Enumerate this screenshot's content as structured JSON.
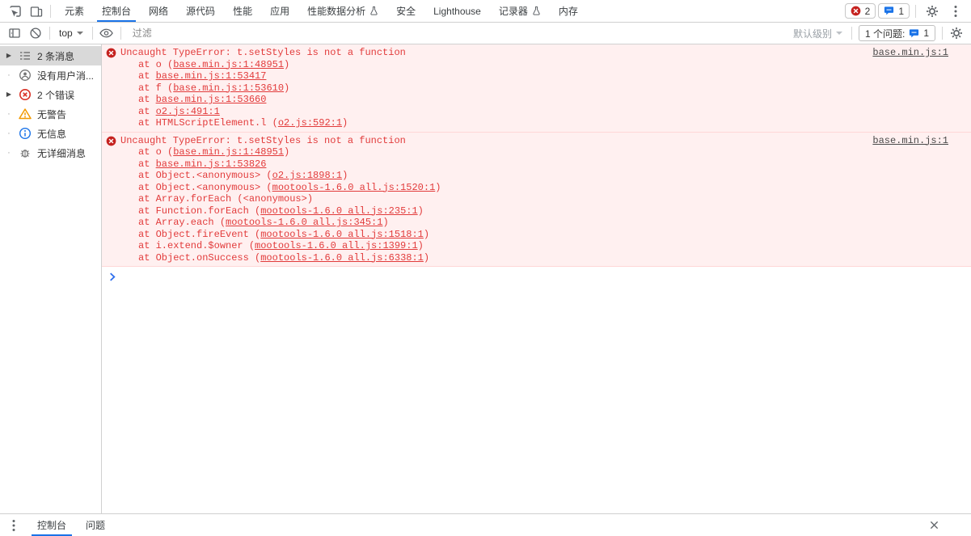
{
  "colors": {
    "accent": "#1a73e8",
    "error_text": "#e23b3b",
    "error_bg": "#fff0f0",
    "error_border": "#ffd7d7",
    "error_icon_fill": "#c5221f",
    "warning_color": "#f29900",
    "prompt_chevron": "#2f6fed"
  },
  "tabbar": {
    "tabs": [
      {
        "id": "elements",
        "label": "元素"
      },
      {
        "id": "console",
        "label": "控制台",
        "active": true
      },
      {
        "id": "network",
        "label": "网络"
      },
      {
        "id": "sources",
        "label": "源代码"
      },
      {
        "id": "performance",
        "label": "性能"
      },
      {
        "id": "application",
        "label": "应用"
      },
      {
        "id": "performance-insights",
        "label": "性能数据分析",
        "flask": true
      },
      {
        "id": "security",
        "label": "安全"
      },
      {
        "id": "lighthouse",
        "label": "Lighthouse"
      },
      {
        "id": "recorder",
        "label": "记录器",
        "flask": true
      },
      {
        "id": "memory",
        "label": "内存"
      }
    ],
    "error_badge_count": "2",
    "message_badge_count": "1"
  },
  "console_toolbar": {
    "context_selector_label": "top",
    "filter_placeholder": "过滤",
    "log_levels_label": "默认级别",
    "issues_label": "1 个问题:",
    "issues_badge_count": "1"
  },
  "sidebar": {
    "items": [
      {
        "id": "all-messages",
        "icon": "list",
        "label": "2 条消息",
        "expandable": true,
        "selected": true
      },
      {
        "id": "user-messages",
        "icon": "user",
        "label": "没有用户消...",
        "expandable": false
      },
      {
        "id": "errors",
        "icon": "error",
        "label": "2 个错误",
        "expandable": true
      },
      {
        "id": "warnings",
        "icon": "warning",
        "label": "无警告",
        "expandable": false
      },
      {
        "id": "info",
        "icon": "info",
        "label": "无信息",
        "expandable": false
      },
      {
        "id": "verbose",
        "icon": "verbose",
        "label": "无详细消息",
        "expandable": false
      }
    ]
  },
  "console": {
    "errors": [
      {
        "message": "Uncaught TypeError: t.setStyles is not a function",
        "source_link": "base.min.js:1",
        "stack": [
          {
            "pre": "at o (",
            "link": "base.min.js:1:48951",
            "post": ")"
          },
          {
            "pre": "at ",
            "link": "base.min.js:1:53417",
            "post": ""
          },
          {
            "pre": "at f (",
            "link": "base.min.js:1:53610",
            "post": ")"
          },
          {
            "pre": "at ",
            "link": "base.min.js:1:53660",
            "post": ""
          },
          {
            "pre": "at ",
            "link": "o2.js:491:1",
            "post": ""
          },
          {
            "pre": "at HTMLScriptElement.l (",
            "link": "o2.js:592:1",
            "post": ")"
          }
        ]
      },
      {
        "message": "Uncaught TypeError: t.setStyles is not a function",
        "source_link": "base.min.js:1",
        "stack": [
          {
            "pre": "at o (",
            "link": "base.min.js:1:48951",
            "post": ")"
          },
          {
            "pre": "at ",
            "link": "base.min.js:1:53826",
            "post": ""
          },
          {
            "pre": "at Object.<anonymous> (",
            "link": "o2.js:1898:1",
            "post": ")"
          },
          {
            "pre": "at Object.<anonymous> (",
            "link": "mootools-1.6.0 all.js:1520:1",
            "post": ")"
          },
          {
            "pre": "at Array.forEach (<anonymous>)",
            "link": "",
            "post": ""
          },
          {
            "pre": "at Function.forEach (",
            "link": "mootools-1.6.0 all.js:235:1",
            "post": ")"
          },
          {
            "pre": "at Array.each (",
            "link": "mootools-1.6.0 all.js:345:1",
            "post": ")"
          },
          {
            "pre": "at Object.fireEvent (",
            "link": "mootools-1.6.0 all.js:1518:1",
            "post": ")"
          },
          {
            "pre": "at i.extend.$owner (",
            "link": "mootools-1.6.0 all.js:1399:1",
            "post": ")"
          },
          {
            "pre": "at Object.onSuccess (",
            "link": "mootools-1.6.0 all.js:6338:1",
            "post": ")"
          }
        ]
      }
    ]
  },
  "drawer": {
    "tabs": [
      {
        "id": "console",
        "label": "控制台",
        "active": true
      },
      {
        "id": "issues",
        "label": "问题"
      }
    ]
  }
}
